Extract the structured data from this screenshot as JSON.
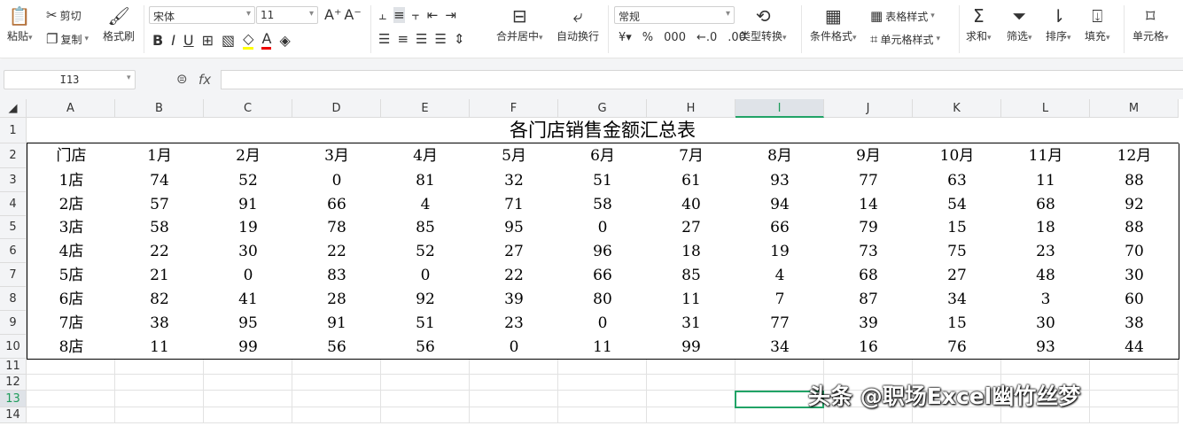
{
  "ribbon": {
    "paste": "粘贴",
    "cut": "剪切",
    "copy": "复制",
    "format_painter": "格式刷",
    "font_name": "宋体",
    "font_size": "11",
    "merge_center": "合并居中",
    "wrap_text": "自动换行",
    "number_format": "常规",
    "type_convert": "类型转换",
    "conditional_format": "条件格式",
    "table_style": "表格样式",
    "cell_style": "单元格样式",
    "sum": "求和",
    "filter": "筛选",
    "sort": "排序",
    "fill": "填充",
    "cell": "单元格"
  },
  "formula_bar": {
    "name_box": "I13",
    "fx": "fx",
    "value": ""
  },
  "columns": [
    "A",
    "B",
    "C",
    "D",
    "E",
    "F",
    "G",
    "H",
    "I",
    "J",
    "K",
    "L",
    "M"
  ],
  "rows": [
    "1",
    "2",
    "3",
    "4",
    "5",
    "6",
    "7",
    "8",
    "9",
    "10",
    "11",
    "12",
    "13",
    "14"
  ],
  "selected": {
    "column": "I",
    "row": "13"
  },
  "sheet": {
    "title": "各门店销售金额汇总表",
    "headers": [
      "门店",
      "1月",
      "2月",
      "3月",
      "4月",
      "5月",
      "6月",
      "7月",
      "8月",
      "9月",
      "10月",
      "11月",
      "12月"
    ],
    "data": [
      [
        "1店",
        "74",
        "52",
        "0",
        "81",
        "32",
        "51",
        "61",
        "93",
        "77",
        "63",
        "11",
        "88"
      ],
      [
        "2店",
        "57",
        "91",
        "66",
        "4",
        "71",
        "58",
        "40",
        "94",
        "14",
        "54",
        "68",
        "92"
      ],
      [
        "3店",
        "58",
        "19",
        "78",
        "85",
        "95",
        "0",
        "27",
        "66",
        "79",
        "15",
        "18",
        "88"
      ],
      [
        "4店",
        "22",
        "30",
        "22",
        "52",
        "27",
        "96",
        "18",
        "19",
        "73",
        "75",
        "23",
        "70"
      ],
      [
        "5店",
        "21",
        "0",
        "83",
        "0",
        "22",
        "66",
        "85",
        "4",
        "68",
        "27",
        "48",
        "30"
      ],
      [
        "6店",
        "82",
        "41",
        "28",
        "92",
        "39",
        "80",
        "11",
        "7",
        "87",
        "34",
        "3",
        "60"
      ],
      [
        "7店",
        "38",
        "95",
        "91",
        "51",
        "23",
        "0",
        "31",
        "77",
        "39",
        "15",
        "30",
        "38"
      ],
      [
        "8店",
        "11",
        "99",
        "56",
        "56",
        "0",
        "11",
        "99",
        "34",
        "16",
        "76",
        "93",
        "44"
      ]
    ]
  },
  "watermark": "头条 @职场Excel幽竹丝梦",
  "colors": {
    "accent": "#21a366"
  }
}
